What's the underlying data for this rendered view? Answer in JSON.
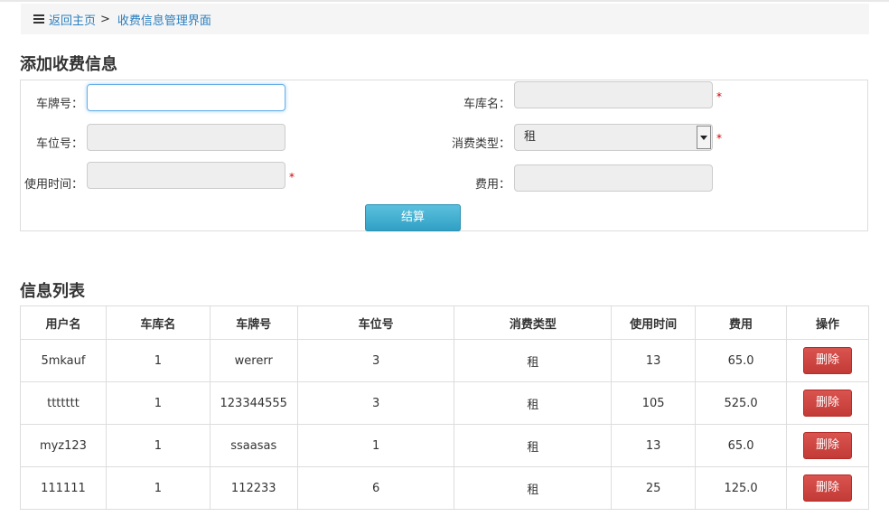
{
  "breadcrumb": {
    "home": "返回主页",
    "separator": ">",
    "current": "收费信息管理界面"
  },
  "form": {
    "title": "添加收费信息",
    "plate_label": "车牌号：",
    "garage_label": "车库名：",
    "space_label": "车位号：",
    "consume_type_label": "消费类型：",
    "consume_type_value": "租",
    "time_label": "使用时间：",
    "fee_label": "费用：",
    "required_mark": "*",
    "submit_label": "结算"
  },
  "list": {
    "title": "信息列表",
    "headers": [
      "用户名",
      "车库名",
      "车牌号",
      "车位号",
      "消费类型",
      "使用时间",
      "费用",
      "操作"
    ],
    "rows": [
      [
        "5mkauf",
        "1",
        "wererr",
        "3",
        "租",
        "13",
        "65.0"
      ],
      [
        "ttttttt",
        "1",
        "123344555",
        "3",
        "租",
        "105",
        "525.0"
      ],
      [
        "myz123",
        "1",
        "ssaasas",
        "1",
        "租",
        "13",
        "65.0"
      ],
      [
        "111111",
        "1",
        "112233",
        "6",
        "租",
        "25",
        "125.0"
      ]
    ],
    "delete_label": "删除"
  },
  "colors": {
    "link": "#2a7fbf",
    "info_button": "#5bc0de",
    "danger_button": "#d9534f",
    "required": "#cc0000"
  }
}
